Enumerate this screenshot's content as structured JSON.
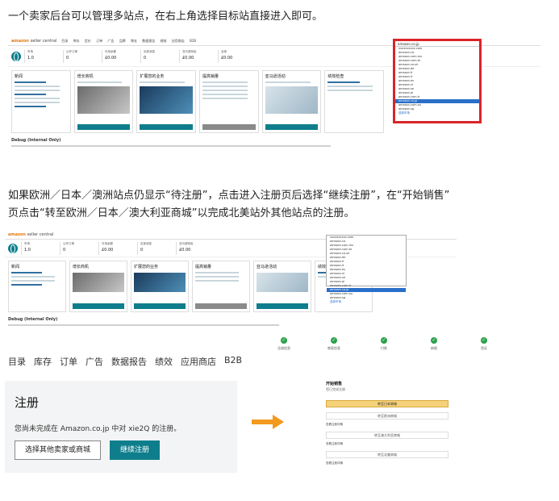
{
  "captions": {
    "first": "一个卖家后台可以管理多站点，在右上角选择目标站直接进入即可。",
    "second_line1": "如果欧洲／日本／澳洲站点仍显示“待注册”，点击进入注册页后选择“继续注册”，在“开始销售”",
    "second_line2": "页点击“转至欧洲／日本／澳大利亚商城”以完成北美站外其他站点的注册。"
  },
  "seller_central": {
    "logo_main": "amazon",
    "logo_sub": "seller central",
    "nav": [
      "目录",
      "库存",
      "定价",
      "订单",
      "广告",
      "品牌",
      "增长",
      "数据报告",
      "绩效",
      "应用商店",
      "B2B"
    ],
    "stats": [
      {
        "label": "市场",
        "value": "1.0"
      },
      {
        "label": "公开订单",
        "value": "0"
      },
      {
        "label": "可用余额",
        "value": "£0.00"
      },
      {
        "label": "买家消息",
        "value": "0"
      },
      {
        "label": "亚马逊特色",
        "value": "£0.00"
      },
      {
        "label": "全球",
        "value": "£0.00"
      }
    ],
    "cards": [
      "新闻",
      "增长商机",
      "扩展您的业务",
      "提高销量",
      "亚马逊活动",
      "绩效检查"
    ],
    "card_buttons": [
      "查看更多",
      "查看更多",
      "查看全部",
      "继续",
      "查看更多",
      ""
    ],
    "debug_label": "Debug (Internal Only)"
  },
  "dropdown": {
    "selected": "amazon.co.jp",
    "items": [
      "xxxxxxxxxx.com",
      "amazon.ca",
      "amazon.com.mx",
      "amazon.com.br",
      "amazon.co.uk",
      "amazon.de",
      "amazon.fr",
      "amazon.it",
      "amazon.es",
      "amazon.nl",
      "amazon.se",
      "amazon.pl",
      "amazon.com.tr",
      "amazon.co.jp",
      "amazon.com.au",
      "amazon.sg"
    ],
    "footer": "选择市场"
  },
  "registration": {
    "nav": [
      "目录",
      "库存",
      "订单",
      "广告",
      "数据报告",
      "绩效",
      "应用商店",
      "B2B"
    ],
    "title": "注册",
    "message": "您尚未完成在 Amazon.co.jp 中对 xie2Q 的注册。",
    "button_secondary": "选择其他卖家或商城",
    "button_primary": "继续注册"
  },
  "steps": [
    "注册信息",
    "商家信息",
    "付款",
    "纳税",
    "验证"
  ],
  "start_selling": {
    "title": "开始销售",
    "subtitle": "您已完成注册",
    "primary_row": "转至日本商城",
    "rows": [
      "转至欧洲商城",
      "转至澳大利亚商城",
      "转至北美商城"
    ],
    "notes": [
      "查看注册详情",
      "查看注册详情",
      "查看注册详情"
    ]
  },
  "colors": {
    "accent": "#0f7e8c",
    "highlight_border": "#d9252a",
    "arrow": "#f39a1e",
    "step_done": "#2aa14a"
  }
}
